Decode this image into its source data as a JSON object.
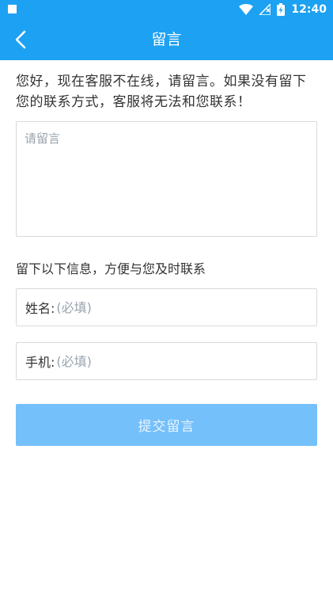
{
  "status_bar": {
    "time": "12:40",
    "icons": [
      "notification-square-icon",
      "wifi-icon",
      "signal-icon",
      "battery-charging-icon"
    ]
  },
  "header": {
    "title": "留言",
    "back_icon": "chevron-left-icon"
  },
  "intro": "您好，现在客服不在线，请留言。如果没有留下您的联系方式，客服将无法和您联系！",
  "message": {
    "placeholder": "请留言",
    "value": ""
  },
  "info_hint": "留下以下信息，方便与您及时联系",
  "fields": {
    "name": {
      "label": "姓名:",
      "placeholder": "(必填)",
      "value": ""
    },
    "phone": {
      "label": "手机:",
      "placeholder": "(必填)",
      "value": ""
    }
  },
  "submit_label": "提交留言",
  "colors": {
    "primary": "#1da1f2",
    "button_disabled": "#74c0fb",
    "border": "#d9d9d9",
    "placeholder": "#9aa3ad"
  }
}
